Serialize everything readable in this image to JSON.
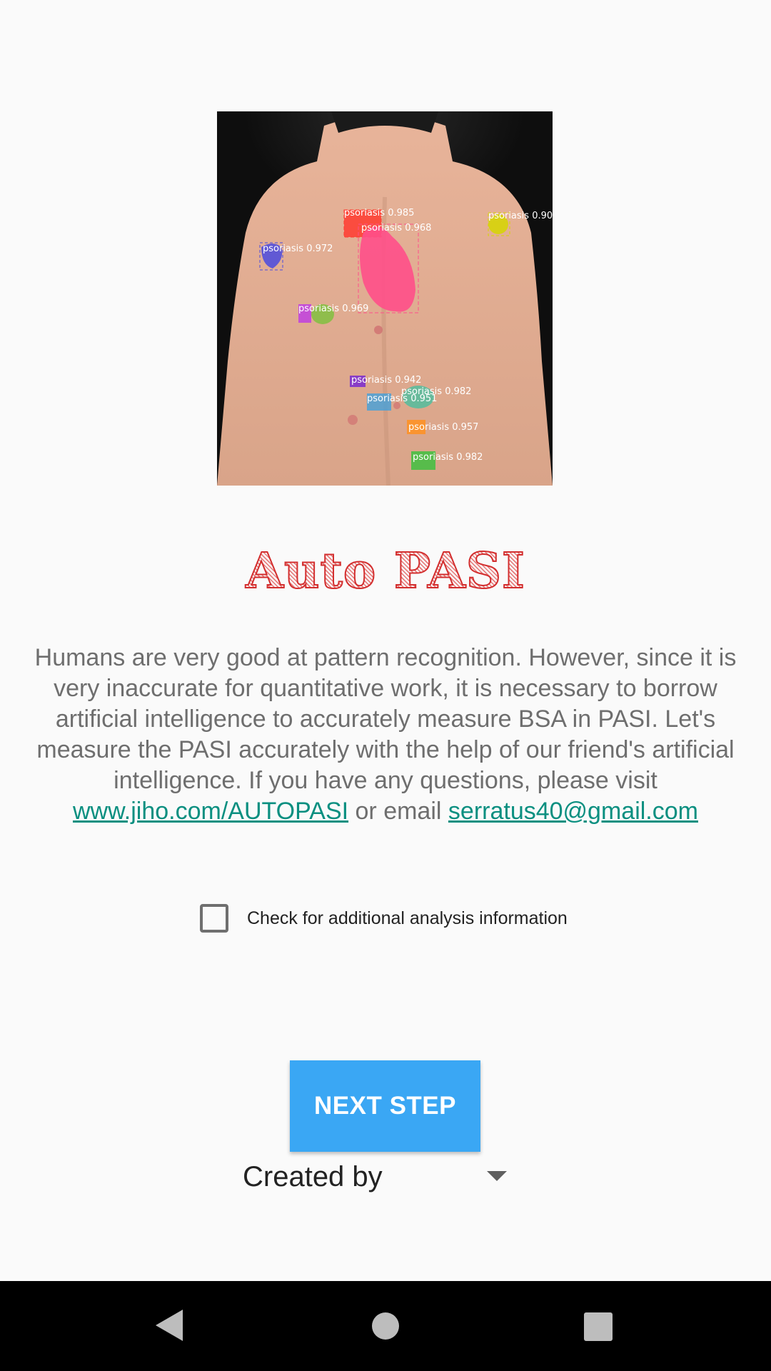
{
  "hero": {
    "detections": [
      {
        "label": "psoriasis 0.985",
        "color": "#ff3b30"
      },
      {
        "label": "psoriasis 0.968",
        "color": "#ff4f8a"
      },
      {
        "label": "psoriasis 0.90",
        "color": "#d6d600"
      },
      {
        "label": "psoriasis 0.972",
        "color": "#4a4adf"
      },
      {
        "label": "psoriasis 0.969",
        "color": "#c040e0"
      },
      {
        "label": "psoriasis 0.942",
        "color": "#7a2ad0"
      },
      {
        "label": "psoriasis 0.982",
        "color": "#40c0a0"
      },
      {
        "label": "psoriasis 0.951",
        "color": "#3aa0e0"
      },
      {
        "label": "psoriasis 0.957",
        "color": "#ff9020"
      },
      {
        "label": "psoriasis 0.982",
        "color": "#40c040"
      }
    ]
  },
  "title": "Auto PASI",
  "description": {
    "text_before": "Humans are very good at pattern recognition. However, since it is very inaccurate for quantitative work, it is necessary to borrow artificial intelligence to accurately measure BSA in PASI. Let's measure the PASI accurately with the help of our friend's artificial intelligence. If you have any questions, please visit ",
    "link_text": "www.jiho.com/AUTOPASI",
    "text_middle": " or email ",
    "email_text": "serratus40@gmail.com"
  },
  "checkbox": {
    "label": "Check for additional analysis information",
    "checked": false
  },
  "next_button": {
    "label": "NEXT STEP",
    "color": "#3aa7f4"
  },
  "spinner": {
    "selected": "Created by"
  },
  "nav": {
    "back_icon": "back-triangle",
    "home_icon": "home-circle",
    "recent_icon": "recents-square"
  }
}
